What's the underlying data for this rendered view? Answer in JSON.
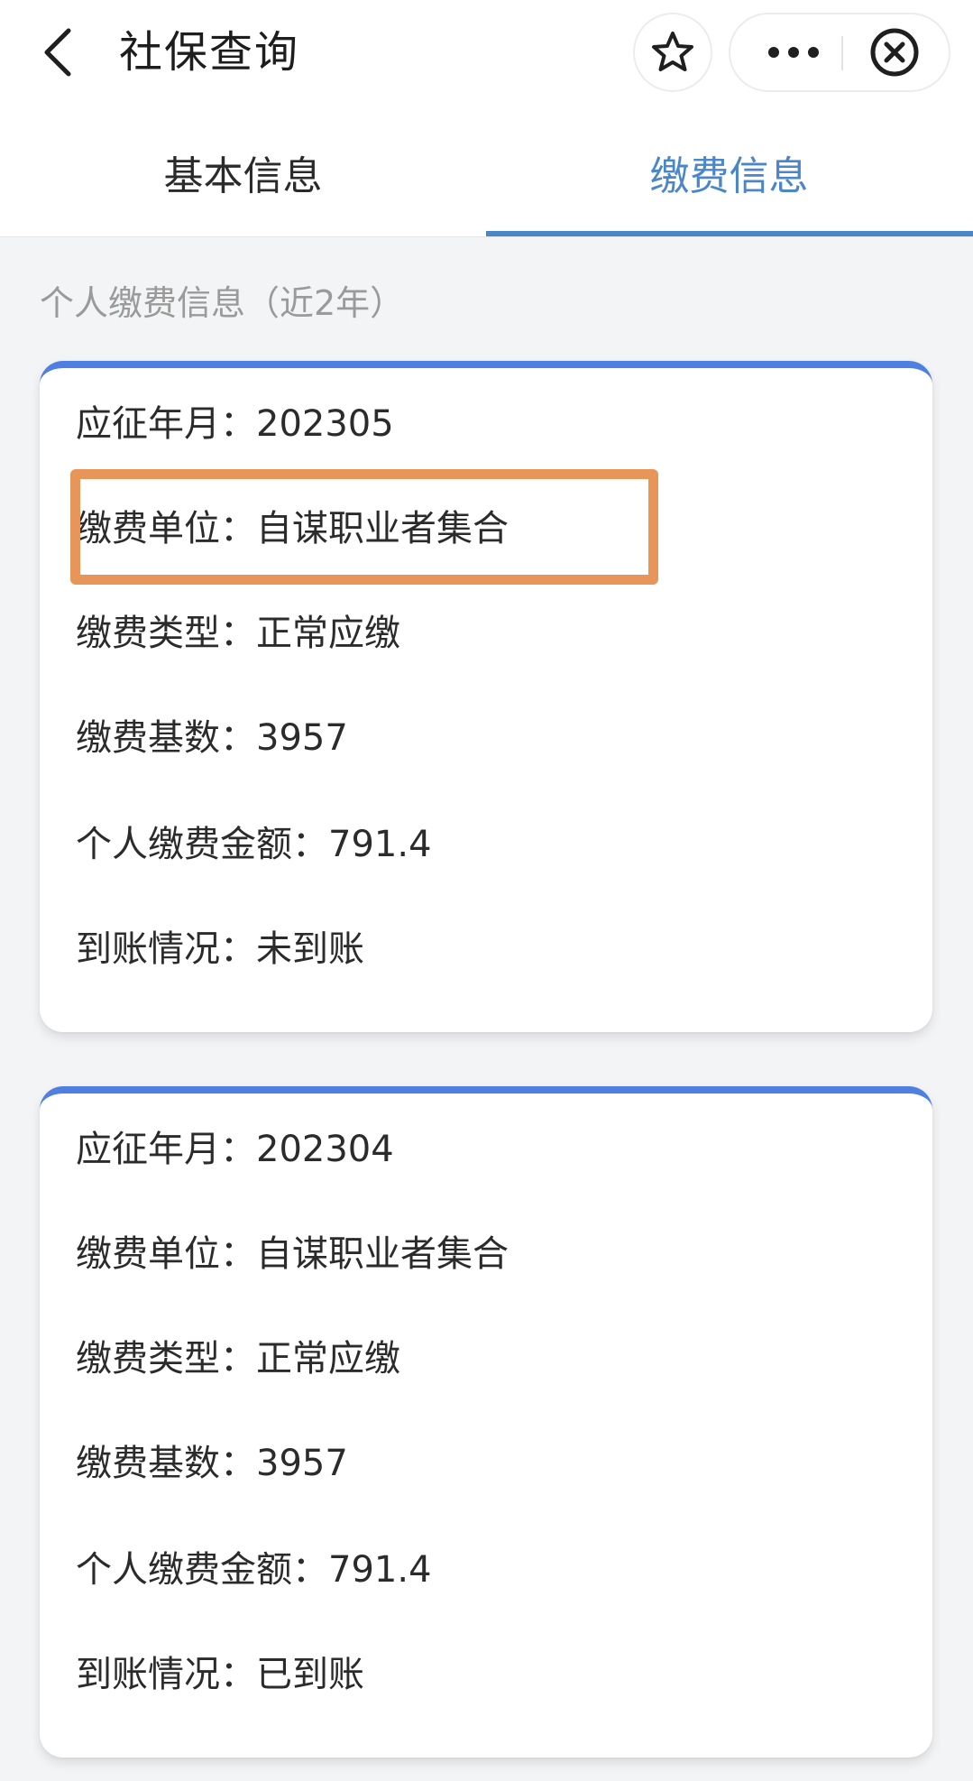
{
  "header": {
    "title": "社保查询"
  },
  "tabs": [
    {
      "label": "基本信息",
      "active": false
    },
    {
      "label": "缴费信息",
      "active": true
    }
  ],
  "section_title": "个人缴费信息（近2年）",
  "records": [
    {
      "rows": [
        {
          "label": "应征年月：",
          "value": "202305"
        },
        {
          "label": "缴费单位：",
          "value": "自谋职业者集合"
        },
        {
          "label": "缴费类型：",
          "value": "正常应缴"
        },
        {
          "label": "缴费基数：",
          "value": "3957"
        },
        {
          "label": "个人缴费金额：",
          "value": "791.4"
        },
        {
          "label": "到账情况：",
          "value": "未到账"
        }
      ]
    },
    {
      "rows": [
        {
          "label": "应征年月：",
          "value": "202304"
        },
        {
          "label": "缴费单位：",
          "value": "自谋职业者集合"
        },
        {
          "label": "缴费类型：",
          "value": "正常应缴"
        },
        {
          "label": "缴费基数：",
          "value": "3957"
        },
        {
          "label": "个人缴费金额：",
          "value": "791.4"
        },
        {
          "label": "到账情况：",
          "value": "已到账"
        }
      ]
    }
  ],
  "colors": {
    "accent": "#4a86c8",
    "card_top_border": "#4f7fe0",
    "highlight_box": "#e8955a"
  },
  "icons": {
    "back": "chevron-left-icon",
    "favorite": "star-icon",
    "more": "more-icon",
    "close": "close-circle-icon"
  }
}
